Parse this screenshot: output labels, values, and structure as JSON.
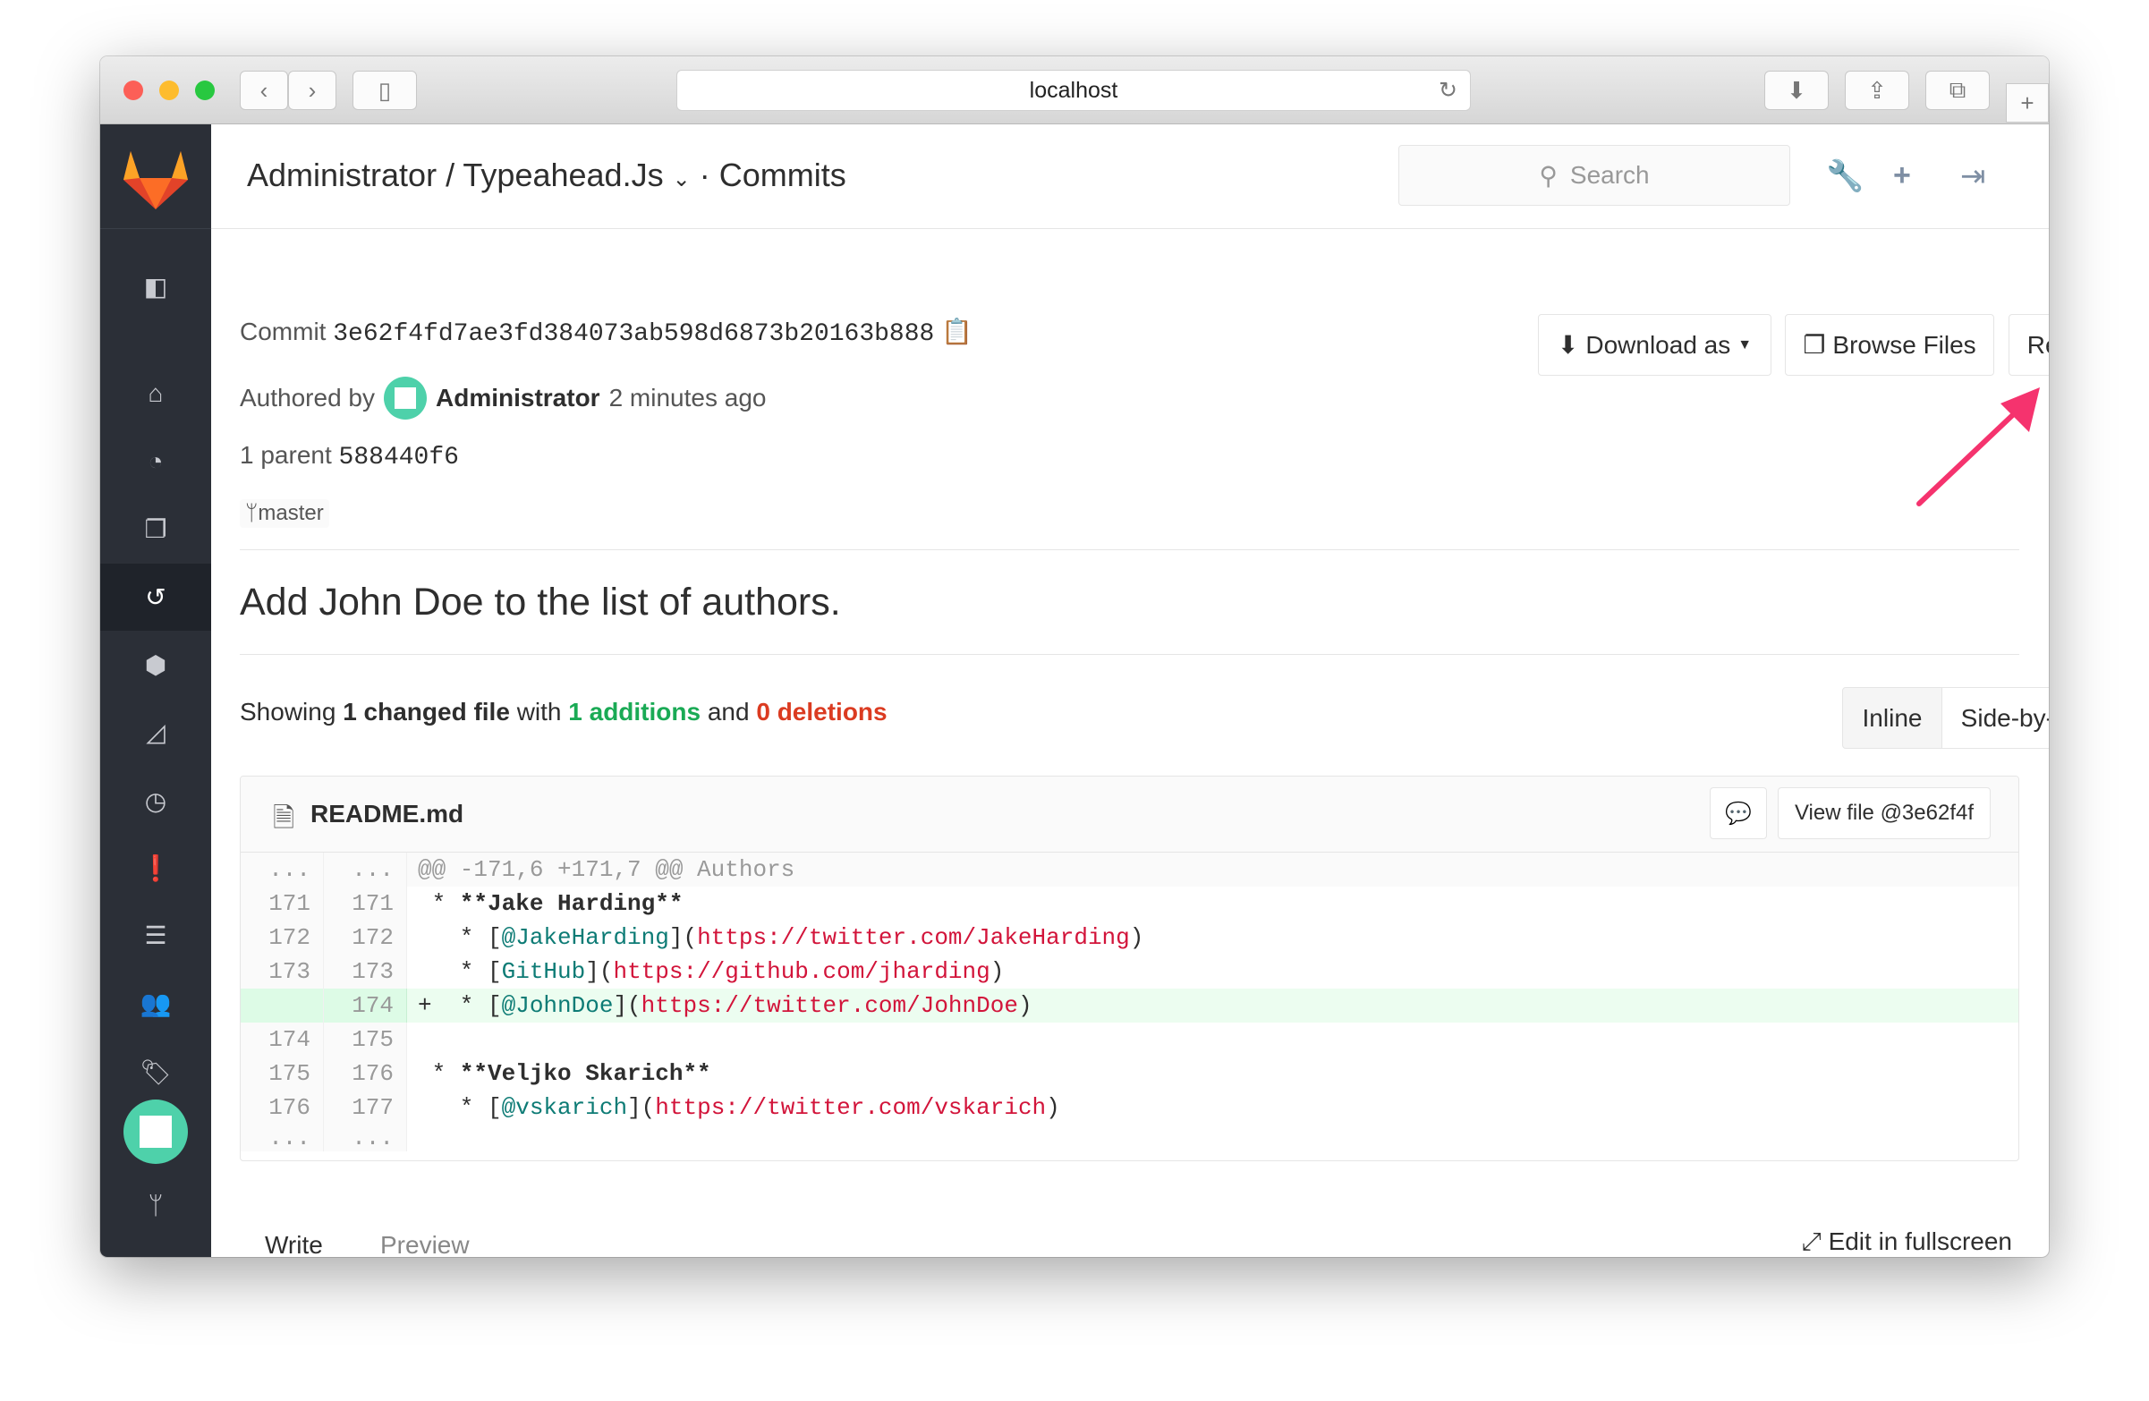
{
  "browser": {
    "url": "localhost"
  },
  "header": {
    "breadcrumb": "Administrator / Typeahead.Js",
    "section": "· Commits",
    "search_placeholder": "Search"
  },
  "commit": {
    "label": "Commit",
    "sha": "3e62f4fd7ae3fd384073ab598d6873b20163b888",
    "authored_label": "Authored by",
    "author": "Administrator",
    "time": "2 minutes ago",
    "parent_label": "1 parent",
    "parent_sha": "588440f6",
    "branch": "master",
    "title": "Add John Doe to the list of authors."
  },
  "actions": {
    "download": "Download as",
    "browse": "Browse Files",
    "revert": "Revert"
  },
  "stats": {
    "showing": "Showing",
    "changed": "1 changed file",
    "with": "with",
    "additions": "1 additions",
    "and": "and",
    "deletions": "0 deletions"
  },
  "view_toggle": {
    "inline": "Inline",
    "side": "Side-by-side",
    "selected": "Inline"
  },
  "file": {
    "name": "README.md",
    "view_file": "View file @3e62f4f"
  },
  "diff": [
    {
      "old": "...",
      "new": "...",
      "type": "hunk",
      "text": "@@ -171,6 +171,7 @@ Authors"
    },
    {
      "old": "171",
      "new": "171",
      "type": "ctx",
      "prefix": " * ",
      "bold": "**Jake Harding**"
    },
    {
      "old": "172",
      "new": "172",
      "type": "ctx",
      "prefix": "   * [",
      "label": "@JakeHarding",
      "mid": "](",
      "url": "https://twitter.com/JakeHarding",
      "end": ")"
    },
    {
      "old": "173",
      "new": "173",
      "type": "ctx",
      "prefix": "   * [",
      "label": "GitHub",
      "mid": "](",
      "url": "https://github.com/jharding",
      "end": ")"
    },
    {
      "old": "",
      "new": "174",
      "type": "add",
      "prefix": "+  * [",
      "label": "@JohnDoe",
      "mid": "](",
      "url": "https://twitter.com/JohnDoe",
      "end": ")"
    },
    {
      "old": "174",
      "new": "175",
      "type": "ctx",
      "prefix": ""
    },
    {
      "old": "175",
      "new": "176",
      "type": "ctx",
      "prefix": " * ",
      "bold": "**Veljko Skarich**"
    },
    {
      "old": "176",
      "new": "177",
      "type": "ctx",
      "prefix": "   * [",
      "label": "@vskarich",
      "mid": "](",
      "url": "https://twitter.com/vskarich",
      "end": ")"
    },
    {
      "old": "...",
      "new": "...",
      "type": "end",
      "prefix": ""
    }
  ],
  "editor": {
    "write": "Write",
    "preview": "Preview",
    "fullscreen": "Edit in fullscreen"
  },
  "colors": {
    "addition": "#1aaa55",
    "deletion": "#db3b21",
    "arrow": "#f5336e",
    "added_bg": "#ecfdf0"
  }
}
